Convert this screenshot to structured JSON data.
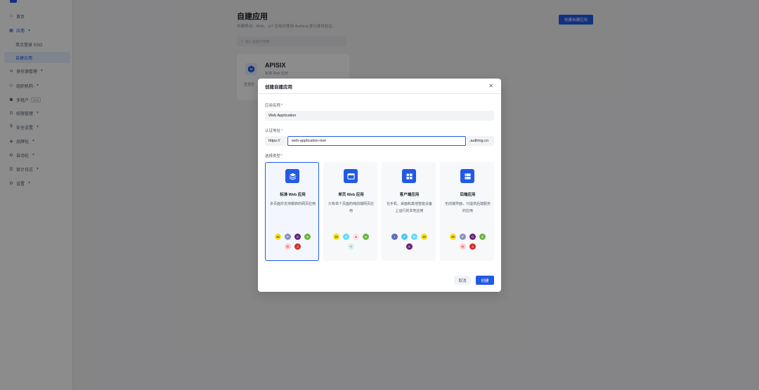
{
  "sidebar": {
    "items": [
      {
        "label": "首页",
        "icon": "home-icon"
      },
      {
        "label": "应用",
        "icon": "apps-icon"
      },
      {
        "label": "单点登录 SSO"
      },
      {
        "label": "自建应用"
      },
      {
        "label": "身份源管理",
        "icon": "identity-icon"
      },
      {
        "label": "组织机构",
        "icon": "org-icon"
      },
      {
        "label": "多租户",
        "icon": "tenant-icon",
        "badge": "beta"
      },
      {
        "label": "权限管理",
        "icon": "permission-icon"
      },
      {
        "label": "安全设置",
        "icon": "security-icon"
      },
      {
        "label": "品牌化",
        "icon": "brand-icon"
      },
      {
        "label": "自动化",
        "icon": "automation-icon"
      },
      {
        "label": "审计日志",
        "icon": "audit-icon"
      },
      {
        "label": "设置",
        "icon": "settings-icon"
      }
    ]
  },
  "main": {
    "title": "自建应用",
    "description": "创建移动、Web、IoT 应用并使用 Authing 进行身份验证。",
    "create_button": "创建自建应用",
    "search_placeholder": "输入关键字搜索",
    "app_card": {
      "name": "APISIX",
      "type": "标准 Web 应用",
      "extra": "登录控"
    }
  },
  "modal": {
    "title": "创建自建应用",
    "name_label": "应用名称",
    "name_value": "Web Application",
    "url_label": "认证地址",
    "url_prefix": "https://",
    "url_value": "web-application-test",
    "url_suffix": ".authing.cn",
    "type_label": "选择类型",
    "required_mark": "*",
    "types": [
      {
        "title": "标准 Web 应用",
        "desc": "多页面并支持跳转的网页应用",
        "selected": true
      },
      {
        "title": "单页 Web 应用",
        "desc": "只有单个页面的纯前端网页应用",
        "selected": false
      },
      {
        "title": "客户端应用",
        "desc": "在手机、桌面和其他智能设备上运行的本地应用",
        "selected": false
      },
      {
        "title": "后端应用",
        "desc": "无前端界面，只提供后端服务的应用",
        "selected": false
      }
    ],
    "cancel": "取消",
    "confirm": "创建"
  },
  "colors": {
    "primary": "#215ae5",
    "required": "#f53f3f"
  }
}
